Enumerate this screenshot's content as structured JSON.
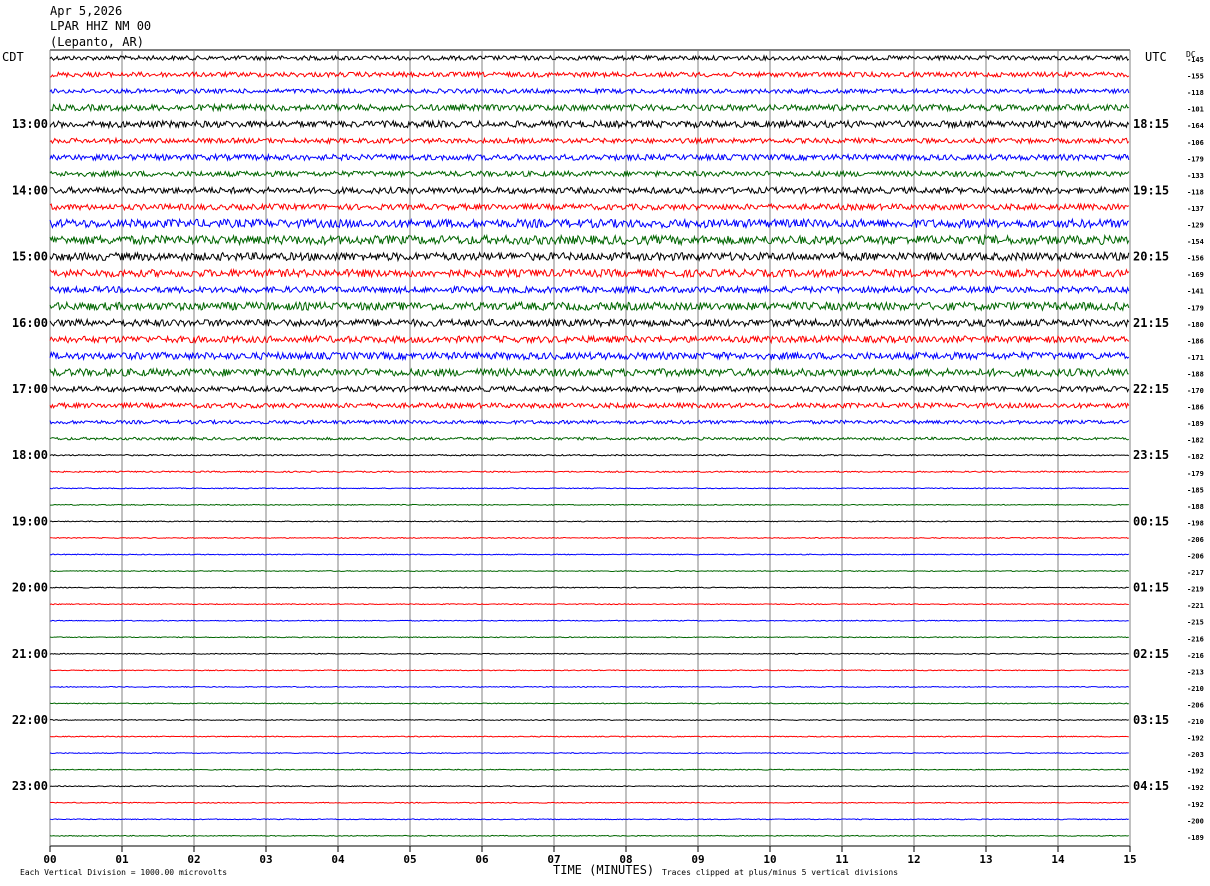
{
  "header": {
    "date": "Apr 5,2026",
    "station": "LPAR HHZ NM 00",
    "location": "(Lepanto, AR)"
  },
  "left_zone": "CDT",
  "right_zone": "UTC",
  "dc_label": "DC",
  "footer": {
    "scale_note": "Each Vertical Division = 1000.00 microvolts",
    "axis_title": "TIME (MINUTES)",
    "clip_note": "Traces clipped at plus/minus 5 vertical divisions"
  },
  "colors": {
    "trace_cycle": [
      "#000000",
      "#ff0000",
      "#0000ff",
      "#006600"
    ],
    "grid": "#808080"
  },
  "chart_data": {
    "type": "line",
    "title": "",
    "xlabel": "TIME (MINUTES)",
    "xlim": [
      0,
      15
    ],
    "x_ticks": [
      "00",
      "01",
      "02",
      "03",
      "04",
      "05",
      "06",
      "07",
      "08",
      "09",
      "10",
      "11",
      "12",
      "13",
      "14",
      "15"
    ],
    "left_hour_labels": [
      "13:00",
      "14:00",
      "15:00",
      "16:00",
      "17:00",
      "18:00",
      "19:00",
      "20:00",
      "21:00",
      "22:00",
      "23:00"
    ],
    "right_hour_labels": [
      "18:15",
      "19:15",
      "20:15",
      "21:15",
      "22:15",
      "23:15",
      "00:15",
      "01:15",
      "02:15",
      "03:15",
      "04:15"
    ],
    "rows_per_hour": 4,
    "dc_offsets": [
      -145,
      -155,
      -118,
      -101,
      -164,
      -106,
      -179,
      -133,
      -118,
      -137,
      -129,
      -154,
      -156,
      -169,
      -141,
      -179,
      -180,
      -186,
      -171,
      -188,
      -170,
      -186,
      -189,
      -182,
      -182,
      -179,
      -185,
      -188,
      -198,
      -206,
      -206,
      -217,
      -219,
      -221,
      -215,
      -216,
      -216,
      -213,
      -210,
      -206,
      -210,
      -192,
      -203,
      -192,
      -192,
      -192,
      -200,
      -189
    ],
    "series": [
      {
        "values": [
          1.0,
          1.1,
          1.0,
          1.4,
          1.5,
          1.1,
          1.3,
          1.2,
          1.4,
          1.3,
          1.9,
          2.0,
          1.8,
          1.7,
          1.4,
          1.8,
          1.6,
          1.5,
          1.6,
          1.7,
          1.2,
          1.1,
          0.8,
          0.6,
          0.3,
          0.3,
          0.2,
          0.2,
          0.2,
          0.2,
          0.2,
          0.2,
          0.2,
          0.2,
          0.2,
          0.2,
          0.2,
          0.2,
          0.2,
          0.2,
          0.2,
          0.2,
          0.2,
          0.2,
          0.2,
          0.2,
          0.2,
          0.2
        ]
      }
    ]
  }
}
